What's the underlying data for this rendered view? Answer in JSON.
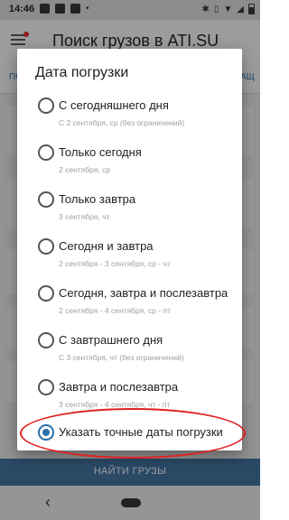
{
  "status_bar": {
    "time": "14:46",
    "icons_left": [
      "notification-icon",
      "image-icon",
      "close-box-icon",
      "dot"
    ],
    "icons_right": [
      "bluetooth-icon",
      "vibrate-icon",
      "wifi-icon",
      "signal-icon",
      "battery-icon"
    ]
  },
  "app": {
    "title": "Поиск грузов в ATI.SU",
    "tab_left": "ПО",
    "tab_right": "МАЩ",
    "find_button": "НАЙТИ ГРУЗЫ"
  },
  "dialog": {
    "title": "Дата погрузки",
    "options": [
      {
        "label": "С сегодняшнего дня",
        "sub": "С 2 сентября, ср (без ограничений)",
        "checked": false
      },
      {
        "label": "Только сегодня",
        "sub": "2 сентября, ср",
        "checked": false
      },
      {
        "label": "Только завтра",
        "sub": "3 сентября, чт",
        "checked": false
      },
      {
        "label": "Сегодня и завтра",
        "sub": "2 сентября - 3 сентября, ср - чт",
        "checked": false
      },
      {
        "label": "Сегодня, завтра и послезавтра",
        "sub": "2 сентября - 4 сентября, ср - пт",
        "checked": false
      },
      {
        "label": "С завтрашнего дня",
        "sub": "С 3 сентября, чт (без ограничений)",
        "checked": false
      },
      {
        "label": "Завтра и послезавтра",
        "sub": "3 сентября - 4 сентября, чт - пт",
        "checked": false
      },
      {
        "label": "Указать точные даты погрузки",
        "sub": "",
        "checked": true
      }
    ]
  },
  "colors": {
    "accent": "#2a6fa8",
    "highlight": "#e02020",
    "find_bar": "#3f6c96"
  }
}
